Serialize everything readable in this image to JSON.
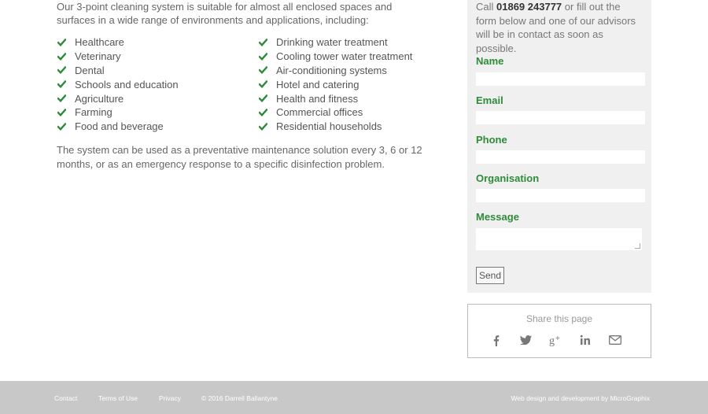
{
  "main": {
    "intro": "Our 3-point cleaning system is suitable for almost all enclosed spaces and surfaces in a wide range of environments and applications, including:",
    "left_list": [
      "Healthcare",
      "Veterinary",
      "Dental",
      "Schools and education",
      "Agriculture",
      "Farming",
      "Food and beverage"
    ],
    "right_list": [
      "Drinking water treatment",
      "Cooling tower water treatment",
      "Air-conditioning systems",
      "Hotel and catering",
      "Health and fitness",
      "Commercial offices",
      "Residential households"
    ],
    "outro": "The system can be used as a preventative maintenance solution every 3, 6 or 12 months, or as an emergency response to a specific disinfection problem."
  },
  "contact": {
    "intro_pre": "Call ",
    "phone": "01869 243777",
    "intro_post": " or fill out the form below and one of our advisors will be in contact as soon as possible.",
    "labels": {
      "name": "Name",
      "email": "Email",
      "phone": "Phone",
      "organisation": "Organisation",
      "message": "Message"
    },
    "values": {
      "name": "",
      "email": "",
      "phone": "",
      "organisation": "",
      "message": ""
    },
    "send_label": "Send"
  },
  "share": {
    "title": "Share this page",
    "icons": [
      "facebook-icon",
      "twitter-icon",
      "google-plus-icon",
      "linkedin-icon",
      "email-icon"
    ]
  },
  "footer": {
    "contact": "Contact",
    "terms": "Terms of Use",
    "privacy": "Privacy",
    "copyright": "© 2016 Darrell Ballantyne",
    "credit": "Web design and development by MicroGraphix"
  },
  "colors": {
    "accent": "#2e8b3a",
    "footer_bg": "#c8c8c8",
    "panel_bg": "#f0f0f0"
  }
}
